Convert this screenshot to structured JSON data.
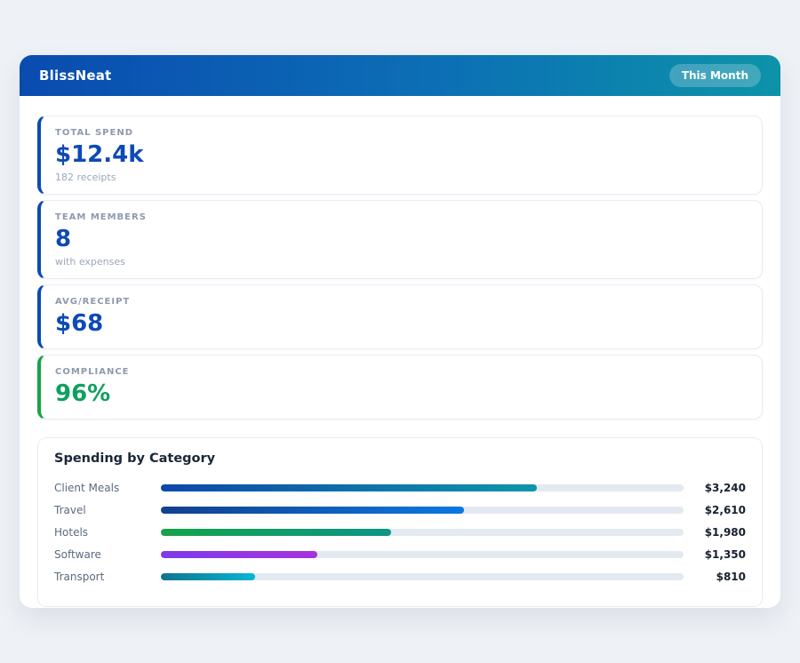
{
  "header": {
    "title": "BlissNeat",
    "badge": "This Month"
  },
  "stats": [
    {
      "label": "TOTAL SPEND",
      "value": "$12.4k",
      "sub": "182 receipts",
      "accent": "#0a4bb0",
      "value_color": "#0d4ab5"
    },
    {
      "label": "TEAM MEMBERS",
      "value": "8",
      "sub": "with expenses",
      "accent": "#0a4bb0",
      "value_color": "#0d4ab5"
    },
    {
      "label": "AVG/RECEIPT",
      "value": "$68",
      "sub": "",
      "accent": "#0a4bb0",
      "value_color": "#0d4ab5"
    },
    {
      "label": "COMPLIANCE",
      "value": "96%",
      "sub": "",
      "accent": "#16a34a",
      "value_color": "#0ea05f"
    }
  ],
  "chart_data": {
    "type": "bar",
    "orientation": "horizontal",
    "title": "Spending by Category",
    "categories": [
      "Client Meals",
      "Travel",
      "Hotels",
      "Software",
      "Transport"
    ],
    "values": [
      3240,
      2610,
      1980,
      1350,
      810
    ],
    "value_labels": [
      "$3,240",
      "$2,610",
      "$1,980",
      "$1,350",
      "$810"
    ],
    "xlim": [
      0,
      4500
    ],
    "grid": false,
    "legend": "none",
    "track_color": "#e3e9f0",
    "bar_colors": [
      [
        "#0b48ad",
        "#0d96ab"
      ],
      [
        "#12408f",
        "#0b77e0"
      ],
      [
        "#16a34a",
        "#0d9488"
      ],
      [
        "#7c3aed",
        "#a832dd"
      ],
      [
        "#0e7490",
        "#08b6d4"
      ]
    ]
  }
}
